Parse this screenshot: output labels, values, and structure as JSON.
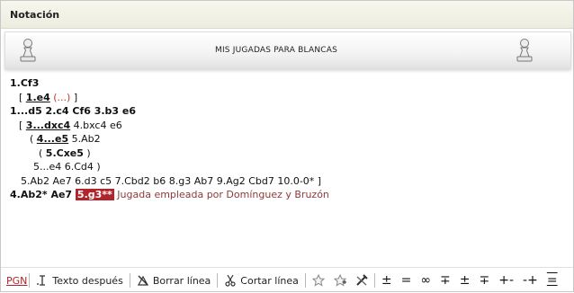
{
  "panel": {
    "title": "Notación"
  },
  "header": {
    "caption": "MIS JUGADAS PARA BLANCAS"
  },
  "moves": {
    "r1": "1.Cf3",
    "r2": {
      "open": "[ ",
      "move": "1.e4",
      "sp": " ",
      "paren": "(...)",
      "close": " ]"
    },
    "r3": "1...d5  2.c4  Cf6  3.b3  e6",
    "r4": {
      "open": "[ ",
      "move": "3...dxc4",
      "rest": " 4.bxc4  e6"
    },
    "r5": {
      "open": "( ",
      "move": "4...e5",
      "rest": " 5.Ab2"
    },
    "r6": {
      "open": "( ",
      "move": "5.Cxe5",
      "close": " )"
    },
    "r7": "5...e4  6.Cd4  )",
    "r8": "5.Ab2  Ae7  6.d3  c5  7.Cbd2  b6  8.g3  Ab7  9.Ag2  Cbd7  10.0-0*  ]",
    "r9": {
      "main": "4.Ab2*  Ae7 ",
      "current": "5.g3**",
      "comment": " Jugada empleada por Domínguez y Bruzón"
    }
  },
  "toolbar": {
    "pgn": "PGN",
    "texto_despues": "Texto después",
    "borrar_linea": "Borrar línea",
    "cortar_linea": "Cortar línea",
    "symbols": [
      "±",
      "=",
      "∞",
      "∓",
      "±",
      "∓",
      "+-",
      "-+",
      "="
    ]
  }
}
